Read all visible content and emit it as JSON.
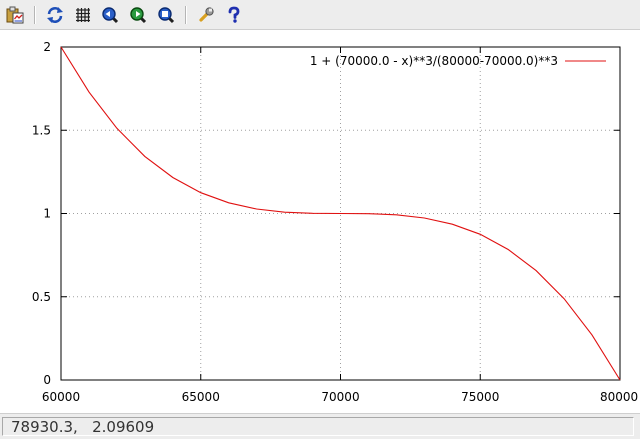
{
  "toolbar": {
    "buttons": [
      {
        "id": "copy",
        "icon": "copy-to-clipboard-icon"
      },
      {
        "id": "replot",
        "icon": "replot-icon"
      },
      {
        "id": "grid",
        "icon": "grid-icon"
      },
      {
        "id": "zoom-prev",
        "icon": "zoom-previous-icon"
      },
      {
        "id": "zoom-next",
        "icon": "zoom-next-icon"
      },
      {
        "id": "zoom-unzoom",
        "icon": "unzoom-icon"
      },
      {
        "id": "options",
        "icon": "wrench-icon"
      },
      {
        "id": "help",
        "icon": "help-icon"
      }
    ]
  },
  "status": {
    "coordinates": "78930.3,   2.09609"
  },
  "colors": {
    "series": "#e01010",
    "grid": "#a0a0a0",
    "axis": "#000000"
  },
  "chart_data": {
    "type": "line",
    "xlim": [
      60000,
      80000
    ],
    "ylim": [
      0,
      2
    ],
    "x_ticks": [
      "60000",
      "65000",
      "70000",
      "75000",
      "80000"
    ],
    "y_ticks": [
      "0",
      "0.5",
      "1",
      "1.5",
      "2"
    ],
    "grid": true,
    "legend_position": "top-right",
    "series": [
      {
        "name": "1 +  (70000.0 - x)**3/(80000-70000.0)**3",
        "x": [
          60000,
          61000,
          62000,
          63000,
          64000,
          65000,
          66000,
          67000,
          68000,
          69000,
          70000,
          71000,
          72000,
          73000,
          74000,
          75000,
          76000,
          77000,
          78000,
          79000,
          80000
        ],
        "y": [
          2.0,
          1.729,
          1.512,
          1.343,
          1.216,
          1.125,
          1.064,
          1.027,
          1.008,
          1.001,
          1.0,
          0.999,
          0.992,
          0.973,
          0.936,
          0.875,
          0.784,
          0.657,
          0.488,
          0.271,
          0.0
        ]
      }
    ]
  }
}
